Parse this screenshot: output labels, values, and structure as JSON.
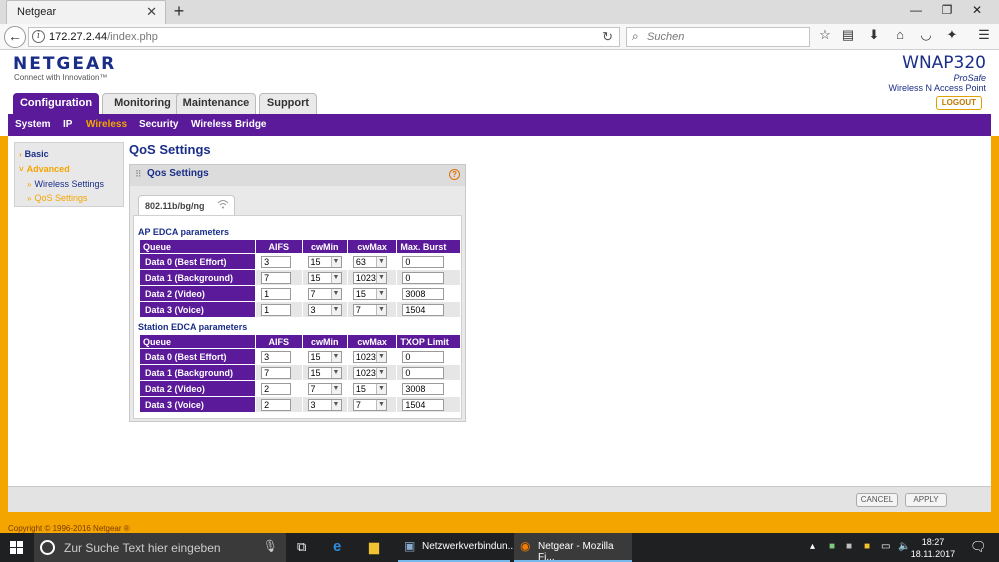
{
  "browser": {
    "tab_title": "Netgear",
    "tab_close": "✕",
    "new_tab": "+",
    "url_host": "172.27.2.44",
    "url_path": "/index.php",
    "search_placeholder": "Suchen",
    "window_controls": [
      "—",
      "❐",
      "✕"
    ]
  },
  "header": {
    "logo": "NETGEAR",
    "logo_tagline": "Connect with Innovation™",
    "model": "WNAP320",
    "model_sub1": "ProSafe",
    "model_sub2": "Wireless N Access Point",
    "logout": "LOGOUT"
  },
  "main_tabs": [
    "Configuration",
    "Monitoring",
    "Maintenance",
    "Support"
  ],
  "active_main_tab": "Configuration",
  "sub_nav": [
    "System",
    "IP",
    "Wireless",
    "Security",
    "Wireless Bridge"
  ],
  "active_sub_nav": "Wireless",
  "side_menu": {
    "basic": "Basic",
    "advanced": "Advanced",
    "wireless_settings": "Wireless Settings",
    "qos_settings": "QoS Settings"
  },
  "page_title": "QoS Settings",
  "panel": {
    "title": "Qos Settings",
    "help": "?",
    "mode_tab": "802.11b/bg/ng"
  },
  "ap_edca": {
    "title": "AP EDCA parameters",
    "headers": [
      "Queue",
      "AIFS",
      "cwMin",
      "cwMax",
      "Max. Burst"
    ],
    "rows": [
      {
        "queue": "Data 0 (Best Effort)",
        "aifs": "3",
        "cwmin": "15",
        "cwmax": "63",
        "last": "0"
      },
      {
        "queue": "Data 1 (Background)",
        "aifs": "7",
        "cwmin": "15",
        "cwmax": "1023",
        "last": "0"
      },
      {
        "queue": "Data 2 (Video)",
        "aifs": "1",
        "cwmin": "7",
        "cwmax": "15",
        "last": "3008"
      },
      {
        "queue": "Data 3 (Voice)",
        "aifs": "1",
        "cwmin": "3",
        "cwmax": "7",
        "last": "1504"
      }
    ]
  },
  "station_edca": {
    "title": "Station EDCA parameters",
    "headers": [
      "Queue",
      "AIFS",
      "cwMin",
      "cwMax",
      "TXOP Limit"
    ],
    "rows": [
      {
        "queue": "Data 0 (Best Effort)",
        "aifs": "3",
        "cwmin": "15",
        "cwmax": "1023",
        "last": "0"
      },
      {
        "queue": "Data 1 (Background)",
        "aifs": "7",
        "cwmin": "15",
        "cwmax": "1023",
        "last": "0"
      },
      {
        "queue": "Data 2 (Video)",
        "aifs": "2",
        "cwmin": "7",
        "cwmax": "15",
        "last": "3008"
      },
      {
        "queue": "Data 3 (Voice)",
        "aifs": "2",
        "cwmin": "3",
        "cwmax": "7",
        "last": "1504"
      }
    ]
  },
  "buttons": {
    "cancel": "CANCEL",
    "apply": "APPLY"
  },
  "footer": {
    "copyright": "Copyright © 1996-2016 Netgear ®"
  },
  "taskbar": {
    "search_text": "Zur Suche Text hier eingeben",
    "app1": "Netzwerkverbindun...",
    "app2": "Netgear - Mozilla Fi...",
    "time": "18:27",
    "date": "18.11.2017"
  },
  "colors": {
    "brand_purple": "#5a1a99",
    "accent_orange": "#f5a500",
    "navy": "#1a2e88"
  }
}
